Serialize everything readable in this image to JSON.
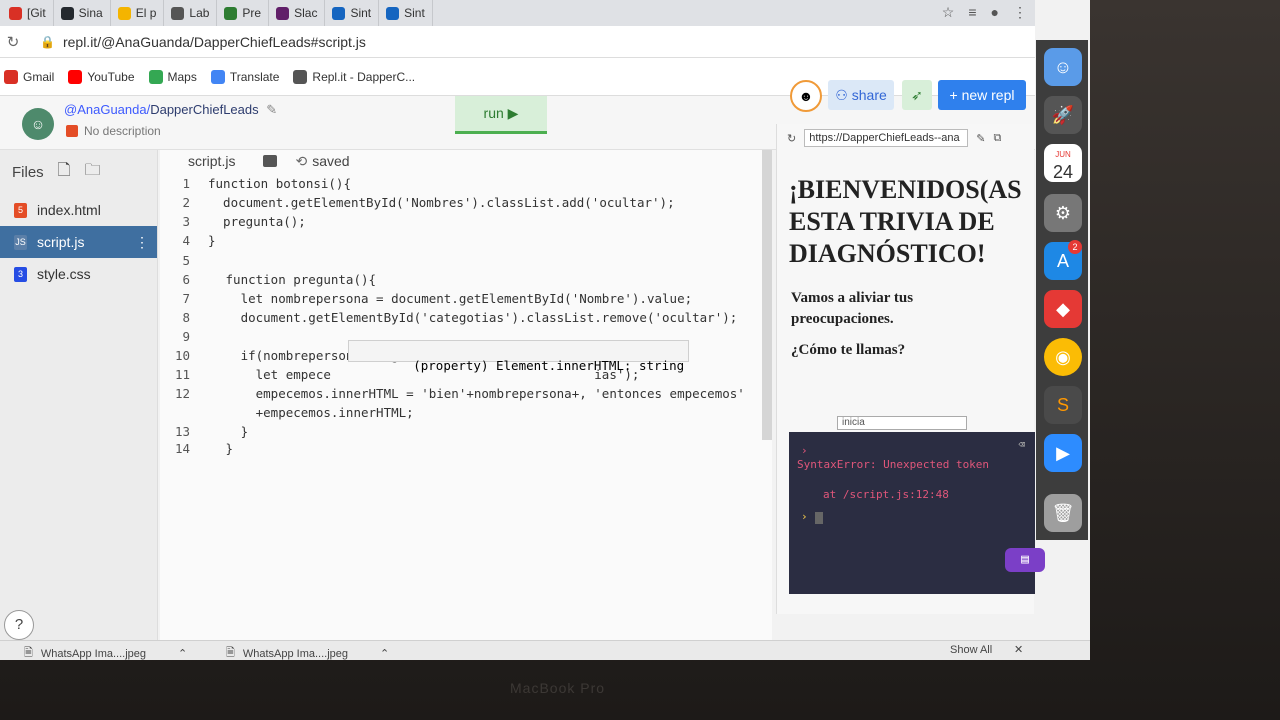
{
  "tabs": [
    {
      "label": "[Git",
      "color": "#d93025"
    },
    {
      "label": "Sina",
      "color": "#24292e"
    },
    {
      "label": "El p",
      "color": "#f4b400"
    },
    {
      "label": "Lab",
      "color": "#555555"
    },
    {
      "label": "Pre",
      "color": "#2e7d32"
    },
    {
      "label": "Slac",
      "color": "#611f69"
    },
    {
      "label": "Sint",
      "color": "#1565c0"
    },
    {
      "label": "Sint",
      "color": "#1565c0"
    }
  ],
  "address": {
    "url": "repl.it/@AnaGuanda/DapperChiefLeads#script.js"
  },
  "bookmarks": [
    {
      "label": "Gmail",
      "color": "#d93025"
    },
    {
      "label": "YouTube",
      "color": "#ff0000"
    },
    {
      "label": "Maps",
      "color": "#34a853"
    },
    {
      "label": "Translate",
      "color": "#4285f4"
    },
    {
      "label": "Repl.it - DapperC...",
      "color": "#555555"
    }
  ],
  "repl": {
    "owner": "@AnaGuanda/",
    "name": "DapperChiefLeads",
    "description": "No description",
    "run_label": "run ▶",
    "share_label": "share",
    "new_repl_label": "+ new repl"
  },
  "files": {
    "header": "Files",
    "items": [
      {
        "name": "index.html",
        "icon": "html-file-icon",
        "color": "#e44d26",
        "glyph": "5"
      },
      {
        "name": "script.js",
        "icon": "js-file-icon",
        "color": "#5b7fa8",
        "glyph": "JS"
      },
      {
        "name": "style.css",
        "icon": "css-file-icon",
        "color": "#264de4",
        "glyph": "3"
      }
    ]
  },
  "editor": {
    "tab_name": "script.js",
    "saved_label": "saved",
    "tooltip": "(property) Element.innerHTML: string",
    "lines": [
      {
        "n": "1",
        "text": "function botonsi(){"
      },
      {
        "n": "2",
        "text": "  document.getElementById('Nombres').classList.add('ocultar');"
      },
      {
        "n": "3",
        "text": "  pregunta();"
      },
      {
        "n": "4",
        "text": "}"
      },
      {
        "n": "5",
        "text": ""
      },
      {
        "n": "6",
        "text": " function pregunta(){"
      },
      {
        "n": "7",
        "text": "   let nombrepersona = document.getElementById('Nombre').value;"
      },
      {
        "n": "8",
        "text": "   document.getElementById('categotias').classList.remove('ocultar');"
      },
      {
        "n": "9",
        "text": ""
      },
      {
        "n": "10",
        "text": "   if(nombrepersona.length !=0){"
      },
      {
        "n": "11",
        "text": "     let empece                                   ias');"
      },
      {
        "n": "12",
        "text": "     empecemos.innerHTML = 'bien'+nombrepersona+, 'entonces empecemos'"
      },
      {
        "n": "",
        "text": "     +empecemos.innerHTML;"
      },
      {
        "n": "13",
        "text": "   }"
      },
      {
        "n": "14",
        "text": " }"
      }
    ]
  },
  "preview": {
    "url": "https://DapperChiefLeads--ana",
    "title": "¡BIENVENIDOS(AS ESTA TRIVIA DE DIAGNÓSTICO!",
    "subtitle": "Vamos a aliviar tus preocupaciones.",
    "question": "¿Cómo te llamas?",
    "input_value": "inicia"
  },
  "console": {
    "error_line": "SyntaxError: Unexpected token",
    "location_line": "at /script.js:12:48",
    "prompt": "›"
  },
  "downloads": {
    "items": [
      "WhatsApp Ima....jpeg",
      "WhatsApp Ima....jpeg"
    ],
    "show_all": "Show All"
  },
  "dock": {
    "calendar_month": "JUN",
    "calendar_day": "24",
    "appstore_badge": "2"
  },
  "laptop_label": "MacBook Pro"
}
